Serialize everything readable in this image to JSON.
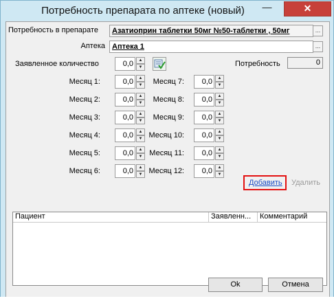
{
  "window": {
    "title": "Потребность препарата по аптеке (новый)",
    "minimize_glyph": "—",
    "close_glyph": "✕"
  },
  "form": {
    "need_label": "Потребность в препарате",
    "need_value": "Азатиоприн таблетки  50мг №50-таблетки , 50мг",
    "pharmacy_label": "Аптека",
    "pharmacy_value": "Аптека 1",
    "ellipsis": "...",
    "declared_label": "Заявленное количество",
    "declared_value": "0,0",
    "need_total_label": "Потребность",
    "need_total_value": "0"
  },
  "months": [
    {
      "label": "Месяц 1:",
      "value": "0,0"
    },
    {
      "label": "Месяц 2:",
      "value": "0,0"
    },
    {
      "label": "Месяц 3:",
      "value": "0,0"
    },
    {
      "label": "Месяц 4:",
      "value": "0,0"
    },
    {
      "label": "Месяц 5:",
      "value": "0,0"
    },
    {
      "label": "Месяц 6:",
      "value": "0,0"
    },
    {
      "label": "Месяц 7:",
      "value": "0,0"
    },
    {
      "label": "Месяц 8:",
      "value": "0,0"
    },
    {
      "label": "Месяц 9:",
      "value": "0,0"
    },
    {
      "label": "Месяц 10:",
      "value": "0,0"
    },
    {
      "label": "Месяц 11:",
      "value": "0,0"
    },
    {
      "label": "Месяц 12:",
      "value": "0,0"
    }
  ],
  "spin": {
    "up": "▲",
    "down": "▼"
  },
  "actions": {
    "add": "Добавить",
    "delete": "Удалить"
  },
  "grid": {
    "columns": [
      "Пациент",
      "Заявленн...",
      "Комментарий"
    ]
  },
  "buttons": {
    "ok": "Ok",
    "cancel": "Отмена"
  },
  "colors": {
    "highlight": "#e31010",
    "link": "#1a4cc4",
    "close": "#c7403a"
  }
}
